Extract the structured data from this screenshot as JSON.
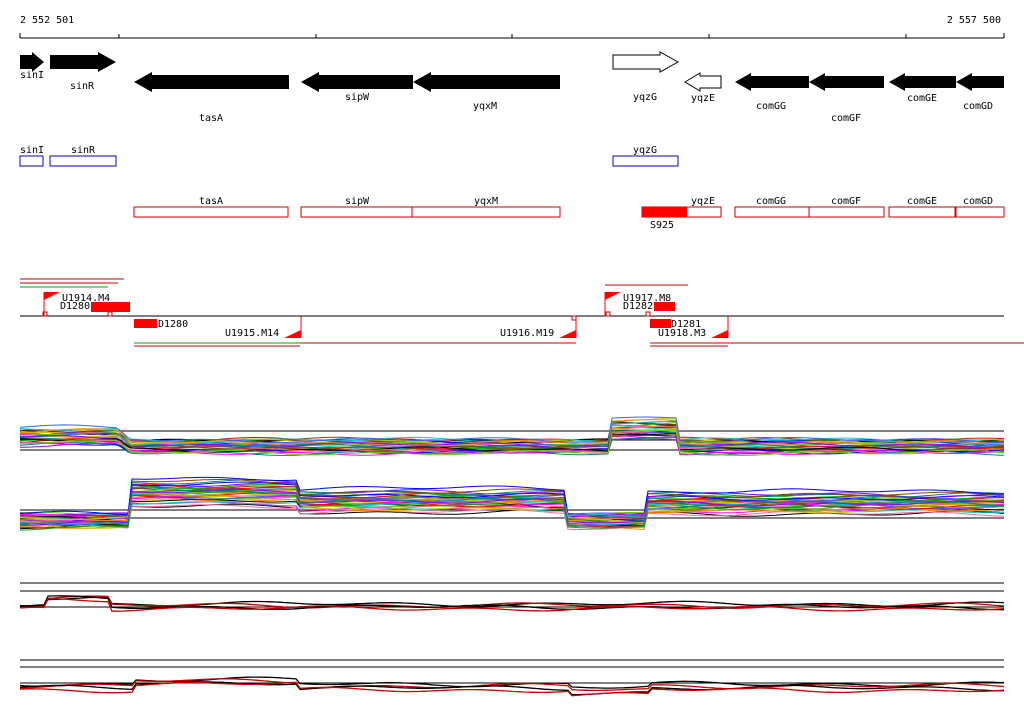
{
  "ruler": {
    "start_label": "2 552 501",
    "end_label": "2 557 500"
  },
  "genes": [
    {
      "name": "sinI",
      "strand": "+",
      "status": "filled"
    },
    {
      "name": "sinR",
      "strand": "+",
      "status": "filled"
    },
    {
      "name": "tasA",
      "strand": "-",
      "status": "filled"
    },
    {
      "name": "sipW",
      "strand": "-",
      "status": "filled"
    },
    {
      "name": "yqxM",
      "strand": "-",
      "status": "filled"
    },
    {
      "name": "yqzG",
      "strand": "+",
      "status": "outline"
    },
    {
      "name": "yqzE",
      "strand": "-",
      "status": "outline"
    },
    {
      "name": "comGG",
      "strand": "-",
      "status": "filled"
    },
    {
      "name": "comGF",
      "strand": "-",
      "status": "filled"
    },
    {
      "name": "comGE",
      "strand": "-",
      "status": "filled"
    },
    {
      "name": "comGD",
      "strand": "-",
      "status": "filled"
    }
  ],
  "forward_boxes": [
    "sinI",
    "sinR",
    "yqzG"
  ],
  "reverse_boxes": [
    "tasA",
    "sipW",
    "yqxM",
    "yqzE",
    "comGG",
    "comGF",
    "comGE",
    "comGD"
  ],
  "reverse_box_marker": "S925",
  "features": {
    "upper": [
      "U1914.M4",
      "D1280",
      "U1917.M8",
      "D1282"
    ],
    "lower": [
      "D1280",
      "U1915.M14",
      "U1916.M19",
      "D1281",
      "U1918.M3"
    ]
  },
  "colors": {
    "gene_filled": "#000000",
    "forward_box": "#0000cc",
    "reverse_box": "#cc0000",
    "feature": "#ff0000",
    "track_1": "#00aa00",
    "track_2": "#cc0000"
  }
}
